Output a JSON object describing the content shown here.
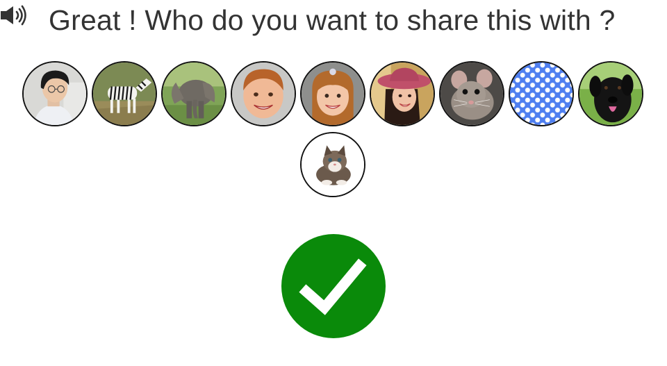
{
  "prompt": {
    "text": "Great ! Who do you want to share this with ?"
  },
  "contacts": [
    {
      "id": "person-glasses",
      "icon": "person-glasses-photo"
    },
    {
      "id": "zebra",
      "icon": "zebra-photo"
    },
    {
      "id": "elephant",
      "icon": "elephant-photo"
    },
    {
      "id": "boy",
      "icon": "boy-photo"
    },
    {
      "id": "girl",
      "icon": "girl-photo"
    },
    {
      "id": "woman-hat",
      "icon": "woman-hat-photo"
    },
    {
      "id": "mouse",
      "icon": "mouse-photo"
    },
    {
      "id": "polka-dots",
      "icon": "polka-dot-pattern"
    },
    {
      "id": "dog",
      "icon": "black-labrador-photo"
    },
    {
      "id": "kitten",
      "icon": "kitten-photo"
    }
  ],
  "colors": {
    "prompt_text": "#333333",
    "confirm_button": "#0a8a0a",
    "avatar_border": "#111111",
    "polka_blue": "#4f7ff0"
  },
  "icons": {
    "speaker": "speaker-icon",
    "confirm": "checkmark-icon"
  }
}
